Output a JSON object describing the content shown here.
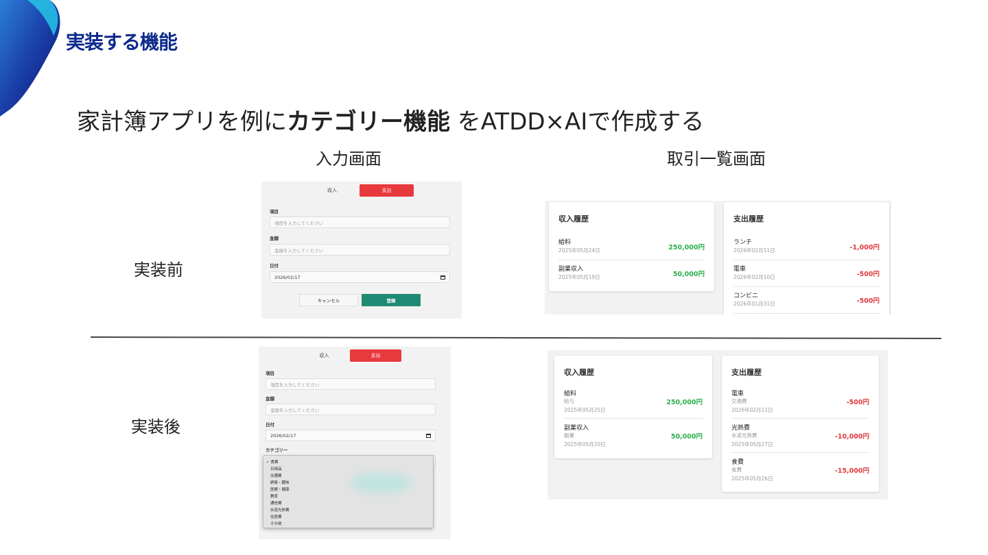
{
  "slide": {
    "title": "実装する機能",
    "subtitle_pre": "家計簿アプリを例に",
    "subtitle_bold": "カテゴリー機能",
    "subtitle_post": " をATDD×AIで作成する"
  },
  "columns": {
    "input": "入力画面",
    "list": "取引一覧画面"
  },
  "rows": {
    "before": "実装前",
    "after": "実装後"
  },
  "form": {
    "tab_income": "収入",
    "tab_expense": "支出",
    "item_label": "項目",
    "item_placeholder": "項目を入力してください",
    "amount_label": "金額",
    "amount_placeholder": "金額を入力してください",
    "date_label": "日付",
    "date_value": "2026/02/17",
    "cancel": "キャンセル",
    "submit": "登録",
    "category_label": "カテゴリー",
    "category_options": [
      "✓ 食費",
      "日用品",
      "交通費",
      "娯楽・趣味",
      "医療・健康",
      "教育",
      "通信費",
      "水道光熱費",
      "住居費",
      "その他"
    ]
  },
  "list_before": {
    "income_title": "収入履歴",
    "income": [
      {
        "name": "給料",
        "date": "2025年05月24日",
        "amount": "250,000円"
      },
      {
        "name": "副業収入",
        "date": "2025年05月19日",
        "amount": "50,000円"
      }
    ],
    "expense_title": "支出履歴",
    "expense": [
      {
        "name": "ランチ",
        "date": "2026年02月11日",
        "amount": "-1,000円"
      },
      {
        "name": "電車",
        "date": "2026年02月10日",
        "amount": "-500円"
      },
      {
        "name": "コンビニ",
        "date": "2026年01月31日",
        "amount": "-500円"
      }
    ]
  },
  "list_after": {
    "income_title": "収入履歴",
    "income": [
      {
        "name": "給料",
        "category": "給与",
        "date": "2025年05月25日",
        "amount": "250,000円"
      },
      {
        "name": "副業収入",
        "category": "副業",
        "date": "2025年05月20日",
        "amount": "50,000円"
      }
    ],
    "expense_title": "支出履歴",
    "expense": [
      {
        "name": "電車",
        "category": "交通費",
        "date": "2026年02月11日",
        "amount": "-500円"
      },
      {
        "name": "光熱費",
        "category": "水道光熱費",
        "date": "2025年05月27日",
        "amount": "-10,000円"
      },
      {
        "name": "食費",
        "category": "食費",
        "date": "2025年05月26日",
        "amount": "-15,000円"
      }
    ]
  },
  "colors": {
    "brand_blue": "#0d2a8c",
    "expense_red": "#e8393d",
    "submit_green": "#1f8a74",
    "positive": "#2aae4a",
    "negative": "#e0393e"
  }
}
